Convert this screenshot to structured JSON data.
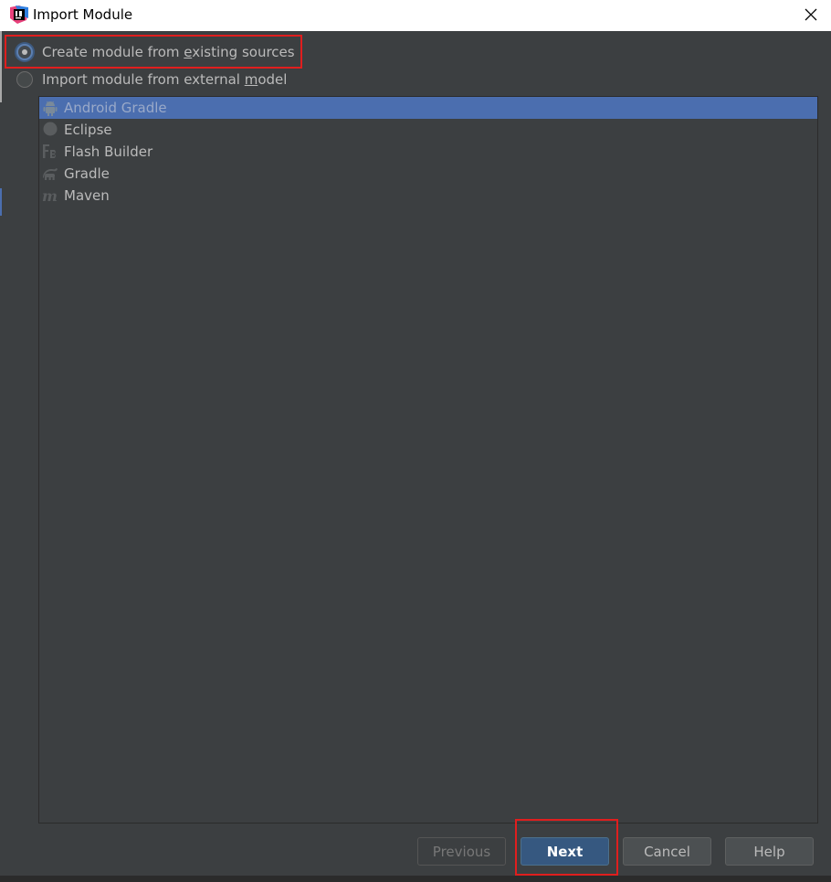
{
  "window": {
    "title": "Import Module"
  },
  "options": {
    "create_pre": "Create module from ",
    "create_u": "e",
    "create_post": "xisting sources",
    "import_pre": "Import module from external ",
    "import_u": "m",
    "import_post": "odel",
    "selected": "create"
  },
  "models": [
    {
      "label": "Android Gradle",
      "icon": "android-icon",
      "selected": true
    },
    {
      "label": "Eclipse",
      "icon": "eclipse-icon",
      "selected": false
    },
    {
      "label": "Flash Builder",
      "icon": "flash-builder-icon",
      "selected": false
    },
    {
      "label": "Gradle",
      "icon": "gradle-icon",
      "selected": false
    },
    {
      "label": "Maven",
      "icon": "maven-icon",
      "selected": false
    }
  ],
  "buttons": {
    "previous": "Previous",
    "next": "Next",
    "cancel": "Cancel",
    "help": "Help"
  },
  "colors": {
    "background": "#3c3f41",
    "selection": "#4b6eaf",
    "primary_button": "#365880",
    "highlight": "#e01e1e"
  }
}
